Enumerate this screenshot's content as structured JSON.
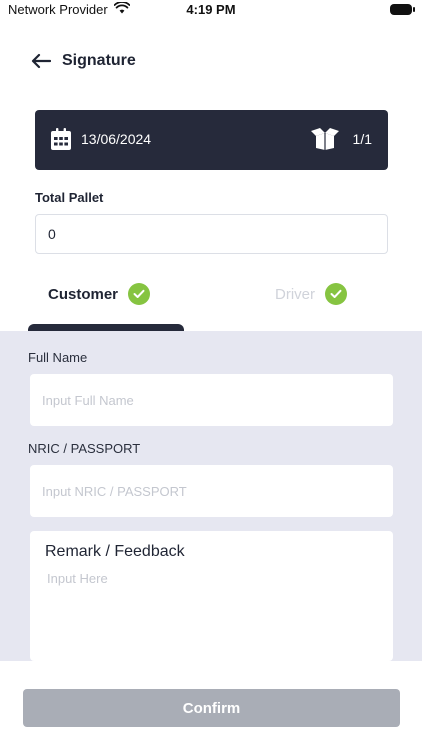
{
  "status_bar": {
    "carrier": "Network Provider",
    "time": "4:19 PM",
    "wifi_icon": "wifi-icon",
    "battery_icon": "battery-icon"
  },
  "header": {
    "back_icon": "arrow-left-icon",
    "title": "Signature"
  },
  "info_card": {
    "background": "#262a3b",
    "date_icon": "calendar-icon",
    "date": "13/06/2024",
    "package_icon": "open-box-icon",
    "count": "1/1"
  },
  "total_pallet": {
    "label": "Total Pallet",
    "value": "0"
  },
  "tabs": [
    {
      "label": "Customer",
      "active": true,
      "completed": true
    },
    {
      "label": "Driver",
      "active": false,
      "completed": true
    }
  ],
  "colors": {
    "accent_dark": "#262a3b",
    "check_green": "#86c441",
    "panel_bg": "#e6e7f1",
    "button_disabled": "#a9adb6"
  },
  "form": {
    "full_name": {
      "label": "Full Name",
      "value": "",
      "placeholder": "Input Full Name"
    },
    "nric": {
      "label": "NRIC / PASSPORT",
      "value": "",
      "placeholder": "Input NRIC / PASSPORT"
    },
    "remark": {
      "label": "Remark / Feedback",
      "value": "",
      "placeholder": "Input Here"
    }
  },
  "footer": {
    "confirm_label": "Confirm"
  }
}
